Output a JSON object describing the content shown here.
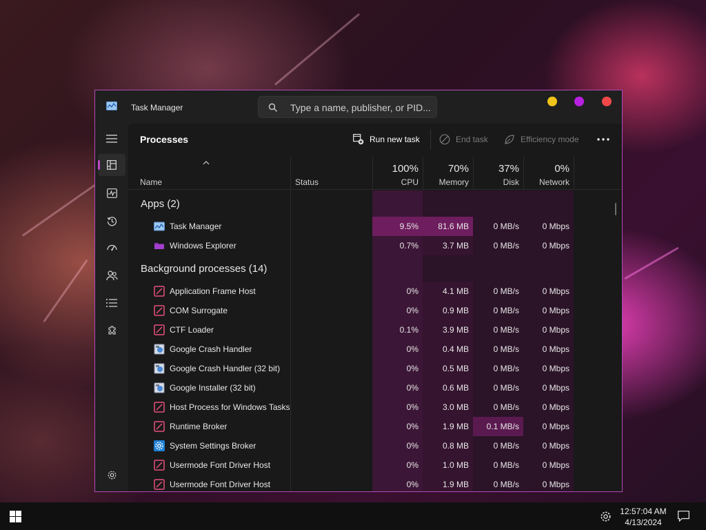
{
  "colors": {
    "accent": "#c048c8",
    "cpu_heat_high": "#6e1e5e",
    "cpu_heat_low": "#3c1636",
    "window_border": "#b04ab8",
    "dot_yellow": "#f0c419",
    "dot_purple": "#b820e0",
    "dot_red": "#f04848"
  },
  "window": {
    "title": "Task Manager",
    "search_placeholder": "Type a name, publisher, or PID..."
  },
  "sidenav": {
    "items": [
      {
        "icon": "hamburger-menu-icon"
      },
      {
        "icon": "processes-icon",
        "active": true
      },
      {
        "icon": "performance-icon"
      },
      {
        "icon": "app-history-icon"
      },
      {
        "icon": "startup-apps-icon"
      },
      {
        "icon": "users-icon"
      },
      {
        "icon": "details-icon"
      },
      {
        "icon": "services-icon"
      },
      {
        "icon": "settings-icon"
      }
    ]
  },
  "toolbar": {
    "title": "Processes",
    "run_new_task": "Run new task",
    "end_task": "End task",
    "efficiency_mode": "Efficiency mode"
  },
  "columns": {
    "name": "Name",
    "status": "Status",
    "cpu": {
      "pct": "100%",
      "label": "CPU"
    },
    "memory": {
      "pct": "70%",
      "label": "Memory"
    },
    "disk": {
      "pct": "37%",
      "label": "Disk"
    },
    "network": {
      "pct": "0%",
      "label": "Network"
    }
  },
  "groups": {
    "apps": "Apps (2)",
    "background": "Background processes (14)"
  },
  "apps": [
    {
      "name": "Task Manager",
      "icon": "task-manager-icon",
      "cpu": "9.5%",
      "memory": "81.6 MB",
      "disk": "0 MB/s",
      "network": "0 Mbps"
    },
    {
      "name": "Windows Explorer",
      "icon": "folder-icon",
      "cpu": "0.7%",
      "memory": "3.7 MB",
      "disk": "0 MB/s",
      "network": "0 Mbps"
    }
  ],
  "background": [
    {
      "name": "Application Frame Host",
      "icon": "app-frame-icon",
      "cpu": "0%",
      "memory": "4.1 MB",
      "disk": "0 MB/s",
      "network": "0 Mbps"
    },
    {
      "name": "COM Surrogate",
      "icon": "app-frame-icon",
      "cpu": "0%",
      "memory": "0.9 MB",
      "disk": "0 MB/s",
      "network": "0 Mbps"
    },
    {
      "name": "CTF Loader",
      "icon": "app-frame-icon",
      "cpu": "0.1%",
      "memory": "3.9 MB",
      "disk": "0 MB/s",
      "network": "0 Mbps"
    },
    {
      "name": "Google Crash Handler",
      "icon": "installer-icon",
      "cpu": "0%",
      "memory": "0.4 MB",
      "disk": "0 MB/s",
      "network": "0 Mbps"
    },
    {
      "name": "Google Crash Handler (32 bit)",
      "icon": "installer-icon",
      "cpu": "0%",
      "memory": "0.5 MB",
      "disk": "0 MB/s",
      "network": "0 Mbps"
    },
    {
      "name": "Google Installer (32 bit)",
      "icon": "installer-icon",
      "cpu": "0%",
      "memory": "0.6 MB",
      "disk": "0 MB/s",
      "network": "0 Mbps"
    },
    {
      "name": "Host Process for Windows Tasks",
      "icon": "app-frame-icon",
      "cpu": "0%",
      "memory": "3.0 MB",
      "disk": "0 MB/s",
      "network": "0 Mbps"
    },
    {
      "name": "Runtime Broker",
      "icon": "app-frame-icon",
      "cpu": "0%",
      "memory": "1.9 MB",
      "disk": "0.1 MB/s",
      "network": "0 Mbps",
      "disk_hot": true
    },
    {
      "name": "System Settings Broker",
      "icon": "gear-icon",
      "cpu": "0%",
      "memory": "0.8 MB",
      "disk": "0 MB/s",
      "network": "0 Mbps"
    },
    {
      "name": "Usermode Font Driver Host",
      "icon": "app-frame-icon",
      "cpu": "0%",
      "memory": "1.0 MB",
      "disk": "0 MB/s",
      "network": "0 Mbps"
    },
    {
      "name": "Usermode Font Driver Host",
      "icon": "app-frame-icon",
      "cpu": "0%",
      "memory": "1.9 MB",
      "disk": "0 MB/s",
      "network": "0 Mbps"
    }
  ],
  "taskbar": {
    "time": "12:57:04 AM",
    "date": "4/13/2024"
  }
}
